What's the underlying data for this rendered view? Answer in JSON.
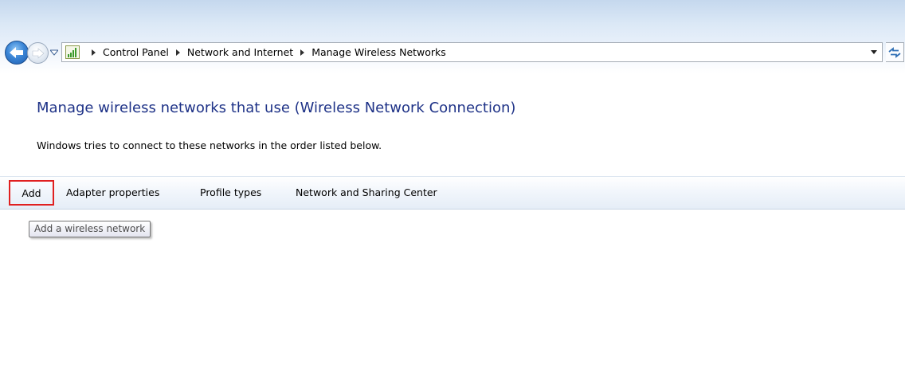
{
  "address_bar": {
    "breadcrumbs": [
      "Control Panel",
      "Network and Internet",
      "Manage Wireless Networks"
    ]
  },
  "icons": {
    "back": "back-arrow-icon",
    "forward": "forward-arrow-icon",
    "recent": "recent-pages-dropdown-icon",
    "location": "network-signal-icon",
    "dropdown": "chevron-down-icon",
    "refresh": "refresh-icon"
  },
  "content": {
    "heading": "Manage wireless networks that use (Wireless Network Connection)",
    "subtext": "Windows tries to connect to these networks in the order listed below."
  },
  "command_bar": {
    "add": "Add",
    "adapter_properties": "Adapter properties",
    "profile_types": "Profile types",
    "network_sharing_center": "Network and Sharing Center"
  },
  "tooltip": {
    "text": "Add a wireless network"
  },
  "colors": {
    "heading": "#1e3287",
    "highlight": "#e02020"
  }
}
